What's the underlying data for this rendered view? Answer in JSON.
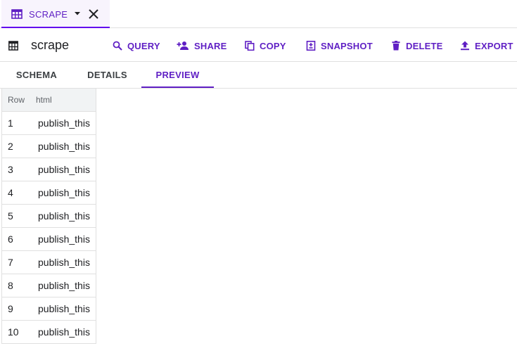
{
  "tab": {
    "label": "SCRAPE",
    "icon": "table-icon",
    "menu_icon": "caret-down-icon",
    "close_icon": "close-icon"
  },
  "toolbar": {
    "title": "scrape",
    "title_icon": "table-icon",
    "buttons": [
      {
        "label": "QUERY",
        "icon": "search-icon"
      },
      {
        "label": "SHARE",
        "icon": "person-add-icon"
      },
      {
        "label": "COPY",
        "icon": "copy-icon"
      },
      {
        "label": "SNAPSHOT",
        "icon": "snapshot-icon"
      },
      {
        "label": "DELETE",
        "icon": "trash-icon"
      },
      {
        "label": "EXPORT",
        "icon": "upload-icon"
      }
    ]
  },
  "subtabs": [
    {
      "label": "SCHEMA"
    },
    {
      "label": "DETAILS"
    },
    {
      "label": "PREVIEW",
      "active": true
    }
  ],
  "preview": {
    "headers": {
      "row": "Row",
      "col": "html"
    },
    "rows": [
      {
        "num": "1",
        "html": "publish_this"
      },
      {
        "num": "2",
        "html": "publish_this"
      },
      {
        "num": "3",
        "html": "publish_this"
      },
      {
        "num": "4",
        "html": "publish_this"
      },
      {
        "num": "5",
        "html": "publish_this"
      },
      {
        "num": "6",
        "html": "publish_this"
      },
      {
        "num": "7",
        "html": "publish_this"
      },
      {
        "num": "8",
        "html": "publish_this"
      },
      {
        "num": "9",
        "html": "publish_this"
      },
      {
        "num": "10",
        "html": "publish_this"
      }
    ]
  },
  "colors": {
    "accent": "#5f1fc4",
    "tab_background": "#f8f4fd",
    "header_background": "#f1f3f4",
    "border": "#e0e0e0"
  }
}
